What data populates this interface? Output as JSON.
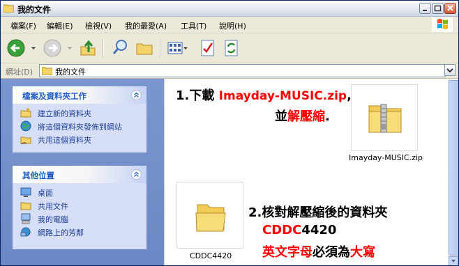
{
  "window": {
    "title": "我的文件"
  },
  "menu": [
    "檔案(F)",
    "編輯(E)",
    "檢視(V)",
    "我的最愛(A)",
    "工具(T)",
    "說明(H)"
  ],
  "address": {
    "label": "網址(D)",
    "value": "我的文件"
  },
  "left_pane": {
    "tasks": {
      "title": "檔案及資料夾工作",
      "items": [
        "建立新的資料夾",
        "將這個資料夾發佈到網站",
        "共用這個資料夾"
      ]
    },
    "places": {
      "title": "其他位置",
      "items": [
        "桌面",
        "共用文件",
        "我的電腦",
        "網路上的芳鄰"
      ]
    }
  },
  "files": [
    {
      "name": "Imayday-MUSIC.zip",
      "icon": "zip-folder-icon"
    },
    {
      "name": "CDDC4420",
      "icon": "folder-icon"
    }
  ],
  "instructions": {
    "step1": {
      "prefix": "1.下載",
      "filename": "Imayday-MUSIC.zip",
      "comma": ",",
      "pre2": "並",
      "action": "解壓縮",
      "end": "."
    },
    "step2": {
      "line1": "2.核對解壓縮後的資料夾",
      "line2": "CDDC",
      "line2b": "4420",
      "line3a": "英文字母",
      "line3b": "必須為",
      "line3c": "大寫"
    }
  },
  "colors": {
    "title_text": "#215dc6",
    "link": "#1c3e96",
    "highlight": "#ff0000"
  }
}
